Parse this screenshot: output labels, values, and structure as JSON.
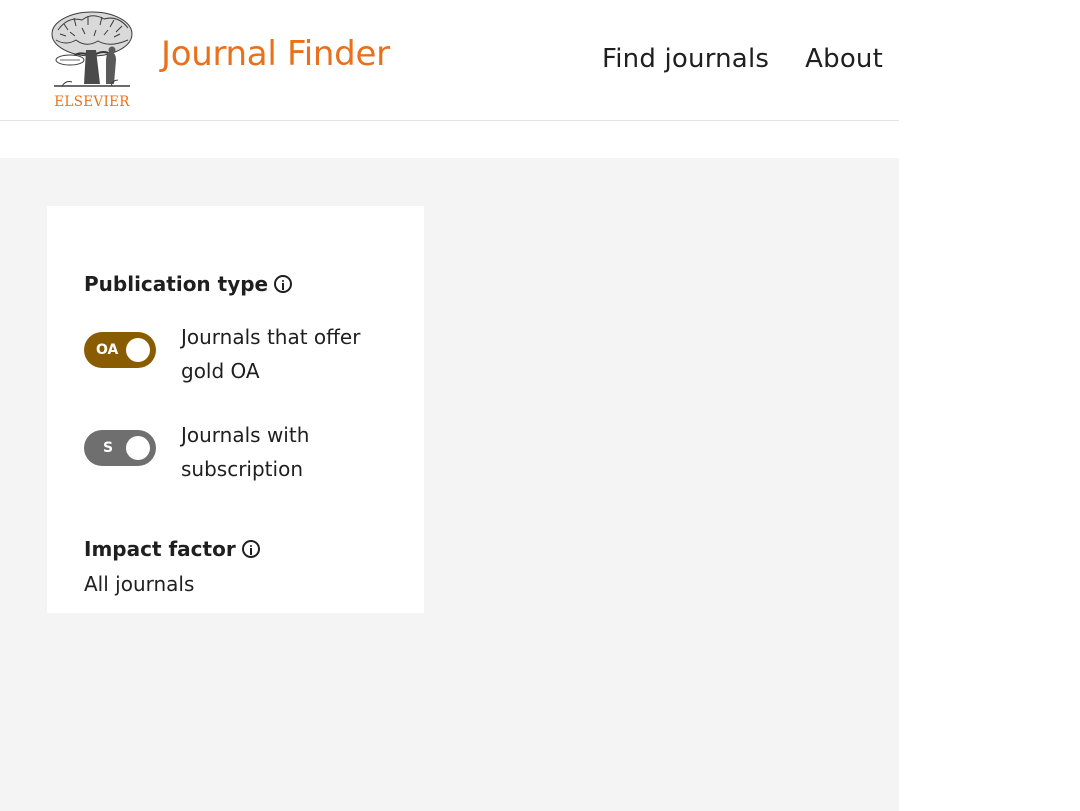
{
  "header": {
    "logo_text": "ELSEVIER",
    "app_title": "Journal Finder",
    "nav": [
      {
        "label": "Find journals"
      },
      {
        "label": "About"
      }
    ]
  },
  "filters": {
    "publication_type": {
      "heading": "Publication type",
      "options": [
        {
          "badge": "OA",
          "text": "Journals that offer gold OA",
          "on": true
        },
        {
          "badge": "S",
          "text": "Journals with subscription",
          "on": false
        }
      ]
    },
    "impact_factor": {
      "heading": "Impact factor",
      "value": "All journals"
    }
  },
  "colors": {
    "brand_orange": "#e9711c",
    "toggle_on": "#8a5c00",
    "toggle_off": "#6f6f6f",
    "content_bg": "#f4f4f4"
  },
  "icons": [
    "elsevier-tree-logo",
    "info-icon"
  ]
}
